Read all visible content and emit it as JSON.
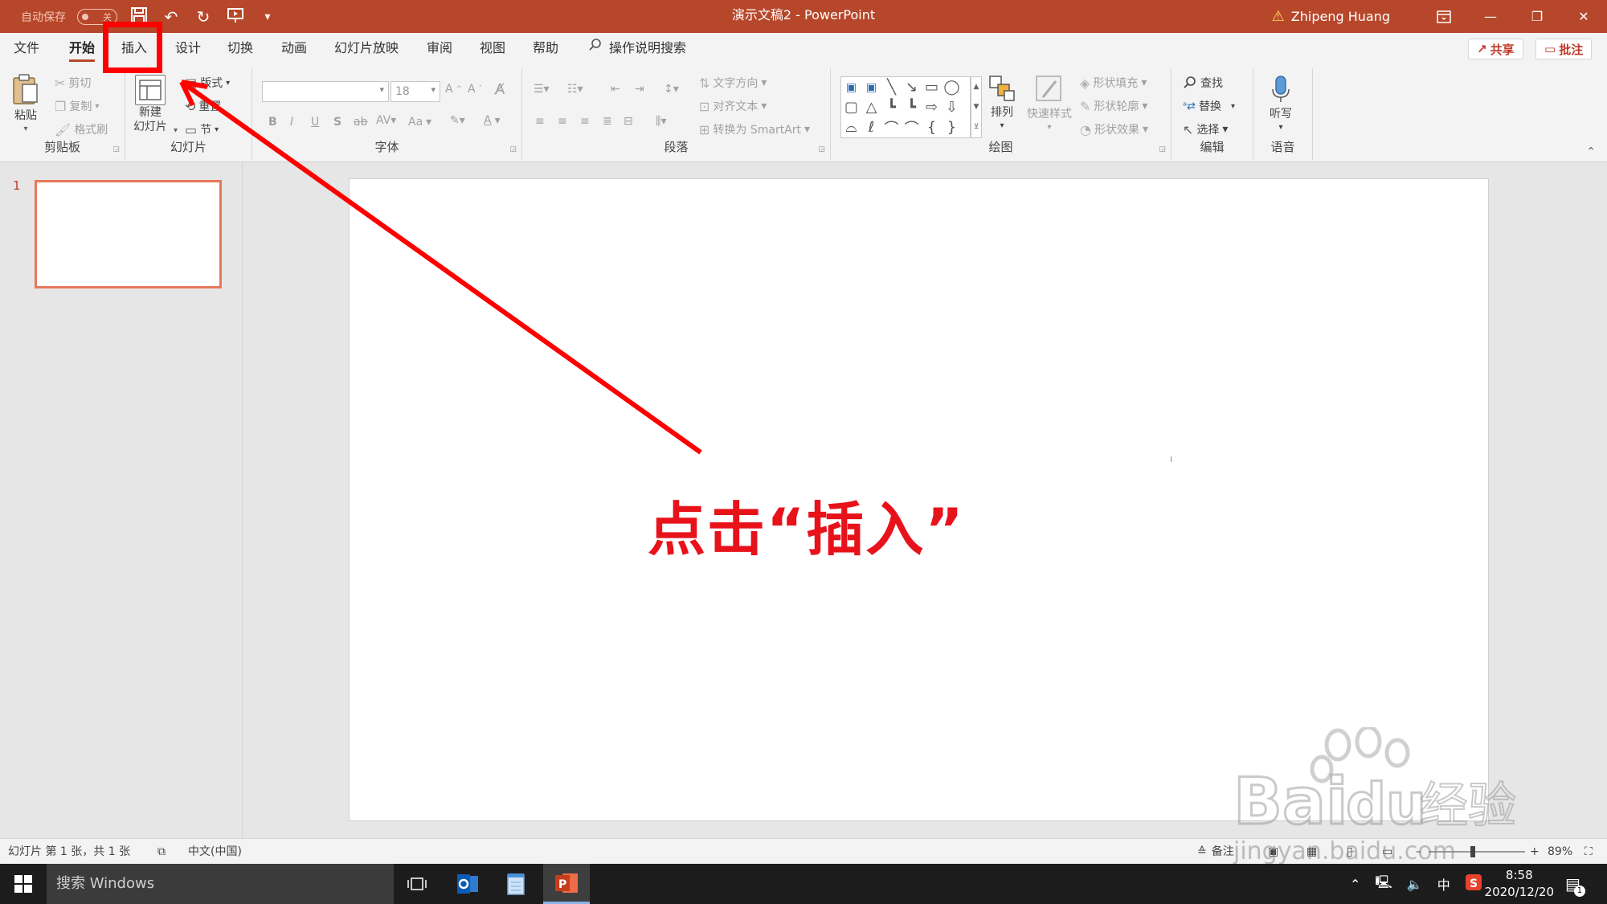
{
  "titlebar": {
    "autosave_label": "自动保存",
    "autosave_state": "关",
    "doc_title": "演示文稿2  -  PowerPoint",
    "user_name": "Zhipeng Huang",
    "accent": "#b7472a"
  },
  "tabs": {
    "items": [
      "文件",
      "开始",
      "插入",
      "设计",
      "切换",
      "动画",
      "幻灯片放映",
      "审阅",
      "视图",
      "帮助"
    ],
    "active": "开始",
    "tell_me": "操作说明搜索",
    "share": "共享",
    "comments": "批注"
  },
  "ribbon": {
    "clipboard": {
      "label": "剪贴板",
      "paste": "粘贴",
      "cut": "剪切",
      "copy": "复制",
      "format_painter": "格式刷"
    },
    "slides": {
      "label": "幻灯片",
      "new_slide_line1": "新建",
      "new_slide_line2": "幻灯片",
      "layout": "版式",
      "reset": "重置",
      "section": "节"
    },
    "font": {
      "label": "字体",
      "font_size": "18",
      "change_case": "Aa"
    },
    "paragraph": {
      "label": "段落",
      "text_direction": "文字方向",
      "align_text": "对齐文本",
      "smartart": "转换为 SmartArt"
    },
    "drawing": {
      "label": "绘图",
      "arrange": "排列",
      "quick_styles": "快速样式",
      "shape_fill": "形状填充",
      "shape_outline": "形状轮廓",
      "shape_effects": "形状效果"
    },
    "editing": {
      "label": "编辑",
      "find": "查找",
      "replace": "替换",
      "select": "选择"
    },
    "voice": {
      "label": "语音",
      "dictate": "听写"
    }
  },
  "thumbnails": {
    "slide_number": "1"
  },
  "annotation": {
    "text": "点击“插入”",
    "color": "#e8121b"
  },
  "statusbar": {
    "slide_info": "幻灯片 第 1 张，共 1 张",
    "language": "中文(中国)",
    "notes": "备注",
    "zoom": "89%"
  },
  "watermark": {
    "url": "jingyan.baidu.com"
  },
  "taskbar": {
    "search_placeholder": "搜索 Windows",
    "ime": "中",
    "time": "8:58",
    "date": "2020/12/20",
    "notification_count": "1"
  }
}
